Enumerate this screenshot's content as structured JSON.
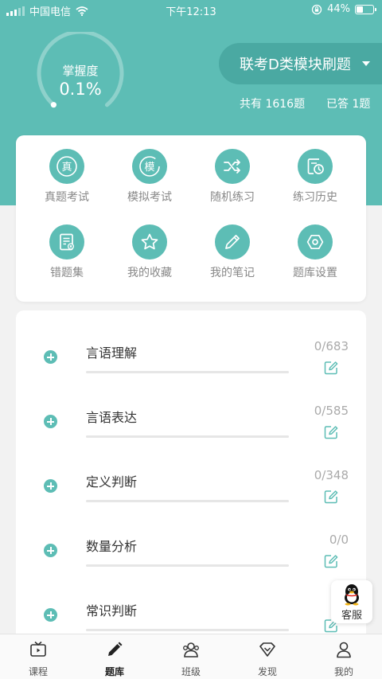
{
  "status_bar": {
    "carrier": "中国电信",
    "time": "下午12:13",
    "battery_text": "44%",
    "battery_level": 0.44
  },
  "mastery": {
    "label": "掌握度",
    "value": "0.1%",
    "fraction": 0.001
  },
  "bank": {
    "title": "联考D类模块刷题"
  },
  "stats": {
    "total": "共有 1616题",
    "answered": "已答 1题"
  },
  "functions": [
    {
      "label": "真题考试",
      "icon": "zhen-icon"
    },
    {
      "label": "模拟考试",
      "icon": "mo-icon"
    },
    {
      "label": "随机练习",
      "icon": "shuffle-icon"
    },
    {
      "label": "练习历史",
      "icon": "history-icon"
    },
    {
      "label": "错题集",
      "icon": "wrong-book-icon"
    },
    {
      "label": "我的收藏",
      "icon": "star-icon"
    },
    {
      "label": "我的笔记",
      "icon": "pencil-icon"
    },
    {
      "label": "题库设置",
      "icon": "settings-icon"
    }
  ],
  "modules": [
    {
      "name": "言语理解",
      "count": "0/683",
      "progress": 0
    },
    {
      "name": "言语表达",
      "count": "0/585",
      "progress": 0
    },
    {
      "name": "定义判断",
      "count": "0/348",
      "progress": 0
    },
    {
      "name": "数量分析",
      "count": "0/0",
      "progress": 0
    },
    {
      "name": "常识判断",
      "count": "0/",
      "progress": 0
    }
  ],
  "service": {
    "label": "客服",
    "icon": "penguin-icon"
  },
  "tabs": [
    {
      "label": "课程",
      "icon": "tv-icon",
      "active": false
    },
    {
      "label": "题库",
      "icon": "pen-icon",
      "active": true
    },
    {
      "label": "班级",
      "icon": "class-icon",
      "active": false
    },
    {
      "label": "发现",
      "icon": "diamond-icon",
      "active": false
    },
    {
      "label": "我的",
      "icon": "user-icon",
      "active": false
    }
  ],
  "colors": {
    "primary": "#5dbdb5",
    "primary_dark": "#4aa9a2",
    "background": "#f2f2f2"
  }
}
